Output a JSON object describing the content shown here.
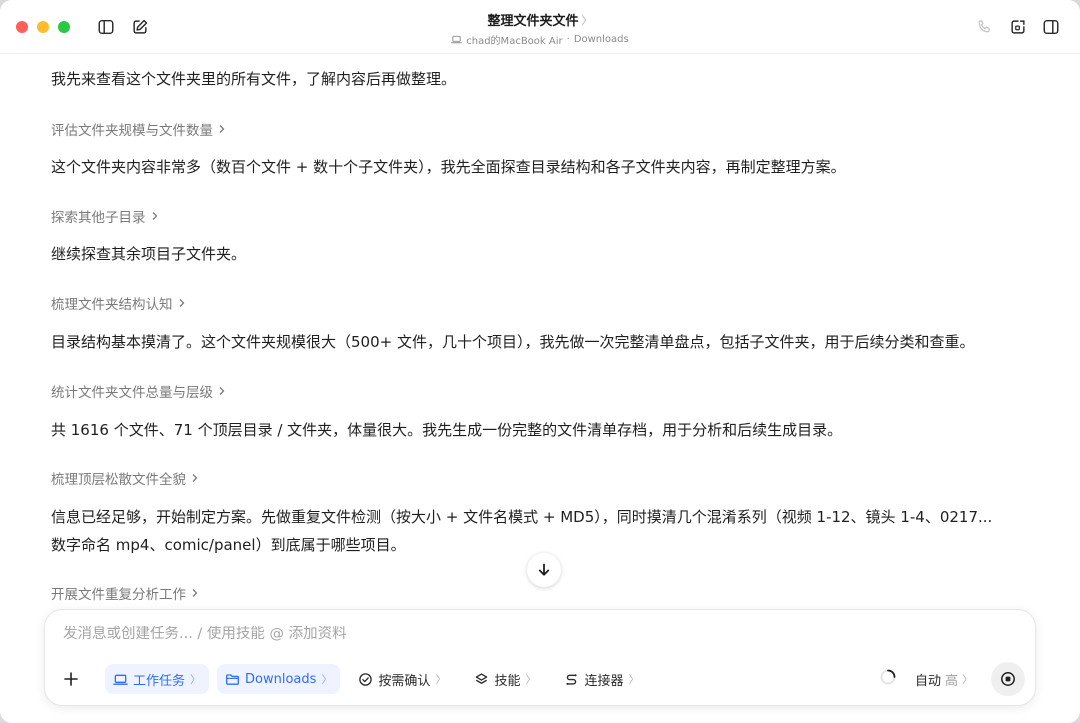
{
  "window": {
    "title": "整理文件夹文件",
    "title_chevron": "〉",
    "subtitle_device": "chad的MacBook Air",
    "subtitle_sep": "·",
    "subtitle_folder": "Downloads"
  },
  "conversation": {
    "messages": [
      "我先来查看这个文件夹里的所有文件，了解内容后再做整理。",
      "这个文件夹内容非常多（数百个文件 + 数十个子文件夹），我先全面探查目录结构和各子文件夹内容，再制定整理方案。",
      "继续探查其余项目子文件夹。",
      "目录结构基本摸清了。这个文件夹规模很大（500+ 文件，几十个项目），我先做一次完整清单盘点，包括子文件夹，用于后续分类和查重。",
      "共 1616 个文件、71 个顶层目录 / 文件夹，体量很大。我先生成一份完整的文件清单存档，用于分析和后续生成目录。",
      "信息已经足够，开始制定方案。先做重复文件检测（按大小 + 文件名模式 + MD5），同时摸清几个混淆系列（视频 1-12、镜头 1-4、0217...",
      "数字命名 mp4、comic/panel）到底属于哪些项目。"
    ],
    "steps": [
      "评估文件夹规模与文件数量",
      "探索其他子目录",
      "梳理文件夹结构认知",
      "统计文件夹文件总量与层级",
      "梳理顶层松散文件全貌",
      "开展文件重复分析工作"
    ]
  },
  "composer": {
    "placeholder": "发消息或创建任务... / 使用技能 @ 添加资料",
    "chips": {
      "work_task": "工作任务",
      "folder": "Downloads",
      "confirm": "按需确认",
      "skills": "技能",
      "connectors": "连接器"
    },
    "chevron": "〉",
    "mode": "自动",
    "level": "高"
  },
  "colors": {
    "accent": "#2f6df6",
    "chip_bg": "#eef3ff",
    "close": "#ff5f57",
    "minimize": "#febc2e",
    "zoom": "#28c840"
  }
}
